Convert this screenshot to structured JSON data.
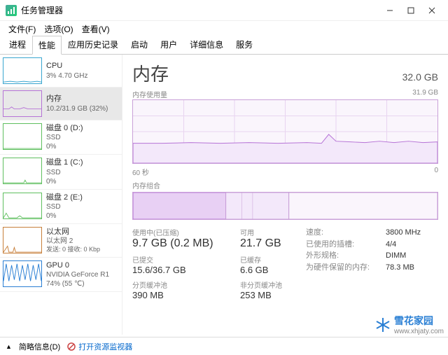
{
  "window": {
    "title": "任务管理器"
  },
  "menu": {
    "file": "文件(F)",
    "options": "选项(O)",
    "view": "查看(V)"
  },
  "tabs": {
    "processes": "进程",
    "performance": "性能",
    "apphistory": "应用历史记录",
    "startup": "启动",
    "users": "用户",
    "details": "详细信息",
    "services": "服务"
  },
  "sidebar": {
    "cpu": {
      "name": "CPU",
      "sub": "3%  4.70 GHz"
    },
    "memory": {
      "name": "内存",
      "sub": "10.2/31.9 GB (32%)"
    },
    "disk0": {
      "name": "磁盘 0 (D:)",
      "sub1": "SSD",
      "sub2": "0%"
    },
    "disk1": {
      "name": "磁盘 1 (C:)",
      "sub1": "SSD",
      "sub2": "0%"
    },
    "disk2": {
      "name": "磁盘 2 (E:)",
      "sub1": "SSD",
      "sub2": "0%"
    },
    "ethernet": {
      "name": "以太网",
      "sub1": "以太网 2",
      "sub2": "发送: 0  接收: 0 Kbp"
    },
    "gpu": {
      "name": "GPU 0",
      "sub1": "NVIDIA GeForce R1",
      "sub2": "74%  (55 ℃)"
    }
  },
  "main": {
    "title": "内存",
    "total": "32.0 GB",
    "graph1_label": "内存使用量",
    "graph1_right": "31.9 GB",
    "graph1_xleft": "60 秒",
    "graph1_xright": "0",
    "graph2_label": "内存组合",
    "stats": {
      "inuse_label": "使用中(已压缩)",
      "inuse": "9.7 GB (0.2 MB)",
      "avail_label": "可用",
      "avail": "21.7 GB",
      "commit_label": "已提交",
      "commit": "15.6/36.7 GB",
      "cached_label": "已缓存",
      "cached": "6.6 GB",
      "paged_label": "分页缓冲池",
      "paged": "390 MB",
      "nonpaged_label": "非分页缓冲池",
      "nonpaged": "253 MB"
    },
    "kv": {
      "speed_k": "速度:",
      "speed_v": "3800 MHz",
      "slots_k": "已使用的插槽:",
      "slots_v": "4/4",
      "form_k": "外形规格:",
      "form_v": "DIMM",
      "reserved_k": "为硬件保留的内存:",
      "reserved_v": "78.3 MB"
    }
  },
  "footer": {
    "brief": "简略信息(D)",
    "resmon": "打开资源监视器"
  },
  "watermark": {
    "text": "雪花家园",
    "url": "www.xhjaty.com"
  },
  "chart_data": {
    "memory_usage_timeline": {
      "type": "area",
      "ylabel": "内存使用量",
      "ylim": [
        0,
        31.9
      ],
      "yunit": "GB",
      "xlabel": "",
      "xrange_seconds": [
        60,
        0
      ],
      "values_approx_gb": [
        10.0,
        10.0,
        10.1,
        10.0,
        10.1,
        10.0,
        10.0,
        10.1,
        10.0,
        10.0,
        10.1,
        10.0,
        10.0,
        10.2,
        10.0,
        10.0,
        10.0,
        10.0,
        10.2,
        11.8,
        10.6,
        10.2,
        10.3,
        10.2,
        10.3,
        10.2,
        10.4,
        10.2,
        10.2,
        10.2
      ]
    },
    "memory_composition": {
      "type": "stacked_bar_single",
      "total_gb": 31.9,
      "segments": [
        {
          "name": "使用中",
          "value_gb": 9.7
        },
        {
          "name": "已缓存/备用",
          "value_gb": 6.6
        },
        {
          "name": "可用",
          "value_gb": 15.6
        }
      ]
    }
  },
  "colors": {
    "memory": "#b673d6",
    "cpu": "#3aa6d0",
    "disk": "#5fbf5f",
    "ethernet": "#c77f3a",
    "gpu": "#2a7fd4"
  }
}
